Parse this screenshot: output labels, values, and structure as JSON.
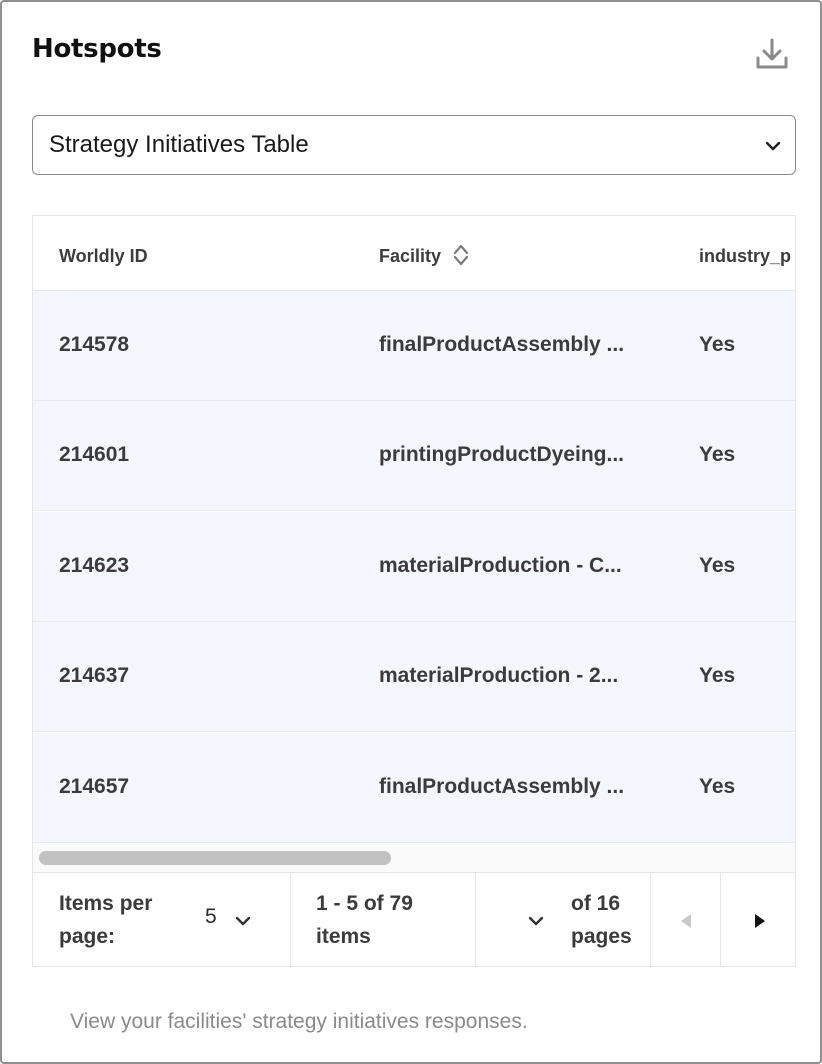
{
  "panel": {
    "title": "Hotspots",
    "download_icon": "download-icon"
  },
  "view_select": {
    "selected": "Strategy Initiatives Table",
    "icon": "chevron-down-icon"
  },
  "table": {
    "columns": [
      "Worldly ID",
      "Facility",
      "industry_p"
    ],
    "rows": [
      {
        "id": "214578",
        "facility": "finalProductAssembly ...",
        "industry": "Yes"
      },
      {
        "id": "214601",
        "facility": "printingProductDyeing...",
        "industry": "Yes"
      },
      {
        "id": "214623",
        "facility": "materialProduction - C...",
        "industry": "Yes"
      },
      {
        "id": "214637",
        "facility": "materialProduction - 2...",
        "industry": "Yes"
      },
      {
        "id": "214657",
        "facility": "finalProductAssembly ...",
        "industry": "Yes"
      }
    ]
  },
  "pagination": {
    "items_per_page_label_1": "Items per",
    "items_per_page_label_2": "page:",
    "items_per_page_value": "5",
    "range_1": "1 - 5 of 79",
    "range_2": "items",
    "of_pages_1": "of 16",
    "of_pages_2": "pages"
  },
  "footer": {
    "note": "View your facilities' strategy initiatives responses."
  },
  "colors": {
    "row_background": "#f3f6fc",
    "border": "#8f8f8f"
  }
}
